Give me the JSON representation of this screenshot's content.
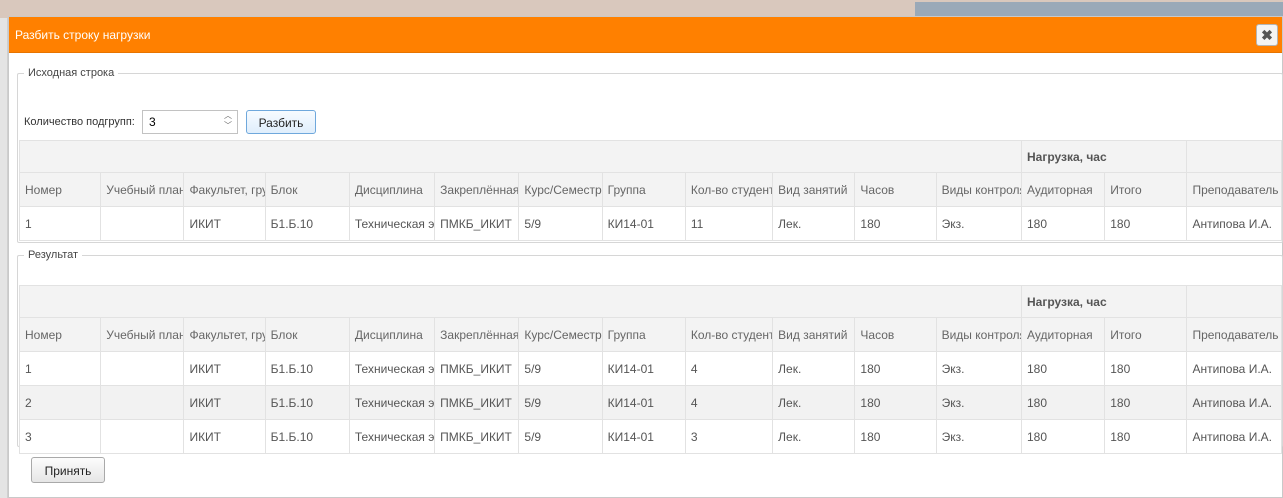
{
  "dialog": {
    "title": "Разбить строку нагрузки",
    "close_glyph": "✖"
  },
  "source": {
    "legend": "Исходная строка",
    "subgroups_label": "Количество подгрупп:",
    "subgroups_value": "3",
    "split_button": "Разбить"
  },
  "result": {
    "legend": "Результат"
  },
  "table": {
    "group_header": "Нагрузка, час",
    "columns": [
      "Номер",
      "Учебный план",
      "Факультет, группа",
      "Блок",
      "Дисциплина",
      "Закреплённая",
      "Курс/Семестр",
      "Группа",
      "Кол-во студентов",
      "Вид занятий",
      "Часов",
      "Виды контроля",
      "Аудиторная",
      "Итого",
      "Преподаватель"
    ]
  },
  "source_rows": [
    [
      "1",
      "",
      "ИКИТ",
      "Б1.Б.10",
      "Техническая электроника",
      "ПМКБ_ИКИТ",
      "5/9",
      "КИ14-01",
      "11",
      "Лек.",
      "180",
      "Экз.",
      "180",
      "180",
      "Антипова И.А."
    ]
  ],
  "result_rows": [
    [
      "1",
      "",
      "ИКИТ",
      "Б1.Б.10",
      "Техническая электроника",
      "ПМКБ_ИКИТ",
      "5/9",
      "КИ14-01",
      "4",
      "Лек.",
      "180",
      "Экз.",
      "180",
      "180",
      "Антипова И.А."
    ],
    [
      "2",
      "",
      "ИКИТ",
      "Б1.Б.10",
      "Техническая электроника",
      "ПМКБ_ИКИТ",
      "5/9",
      "КИ14-01",
      "4",
      "Лек.",
      "180",
      "Экз.",
      "180",
      "180",
      "Антипова И.А."
    ],
    [
      "3",
      "",
      "ИКИТ",
      "Б1.Б.10",
      "Техническая электроника",
      "ПМКБ_ИКИТ",
      "5/9",
      "КИ14-01",
      "3",
      "Лек.",
      "180",
      "Экз.",
      "180",
      "180",
      "Антипова И.А."
    ]
  ],
  "footer": {
    "accept_button": "Принять"
  },
  "colors": {
    "titlebar": "#ff8000",
    "row_alt": "#f2f2f2",
    "header_bg": "#f3f3f3"
  }
}
